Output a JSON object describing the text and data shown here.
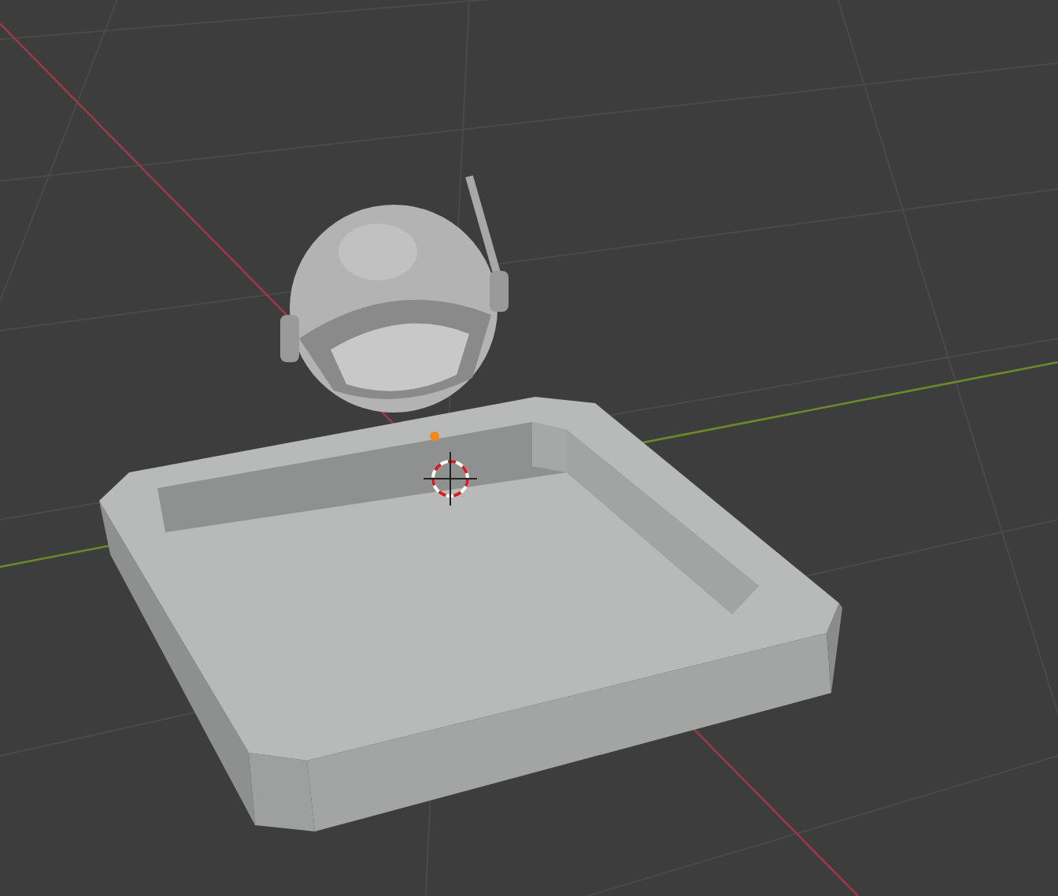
{
  "viewport": {
    "show_grid": true,
    "show_axes": true,
    "show_cursor": true,
    "object_selected": true
  }
}
